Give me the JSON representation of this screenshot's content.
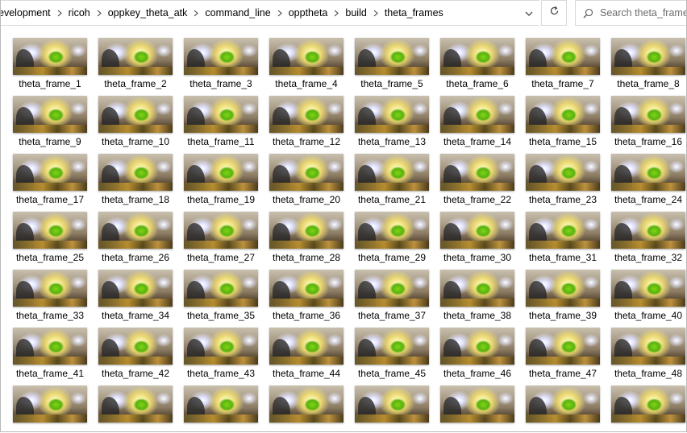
{
  "address_bar": {
    "breadcrumbs": [
      "evelopment",
      "ricoh",
      "oppkey_theta_atk",
      "command_line",
      "opptheta",
      "build",
      "theta_frames"
    ],
    "separator_icon": "chevron-right-icon",
    "dropdown_icon": "chevron-down-icon",
    "refresh_icon": "refresh-icon"
  },
  "search": {
    "placeholder": "Search theta_frames",
    "icon": "search-icon"
  },
  "files": [
    "theta_frame_1",
    "theta_frame_2",
    "theta_frame_3",
    "theta_frame_4",
    "theta_frame_5",
    "theta_frame_6",
    "theta_frame_7",
    "theta_frame_8",
    "theta_frame_9",
    "theta_frame_10",
    "theta_frame_11",
    "theta_frame_12",
    "theta_frame_13",
    "theta_frame_14",
    "theta_frame_15",
    "theta_frame_16",
    "theta_frame_17",
    "theta_frame_18",
    "theta_frame_19",
    "theta_frame_20",
    "theta_frame_21",
    "theta_frame_22",
    "theta_frame_23",
    "theta_frame_24",
    "theta_frame_25",
    "theta_frame_26",
    "theta_frame_27",
    "theta_frame_28",
    "theta_frame_29",
    "theta_frame_30",
    "theta_frame_31",
    "theta_frame_32",
    "theta_frame_33",
    "theta_frame_34",
    "theta_frame_35",
    "theta_frame_36",
    "theta_frame_37",
    "theta_frame_38",
    "theta_frame_39",
    "theta_frame_40",
    "theta_frame_41",
    "theta_frame_42",
    "theta_frame_43",
    "theta_frame_44",
    "theta_frame_45",
    "theta_frame_46",
    "theta_frame_47",
    "theta_frame_48",
    "",
    "",
    "",
    "",
    "",
    "",
    "",
    ""
  ]
}
